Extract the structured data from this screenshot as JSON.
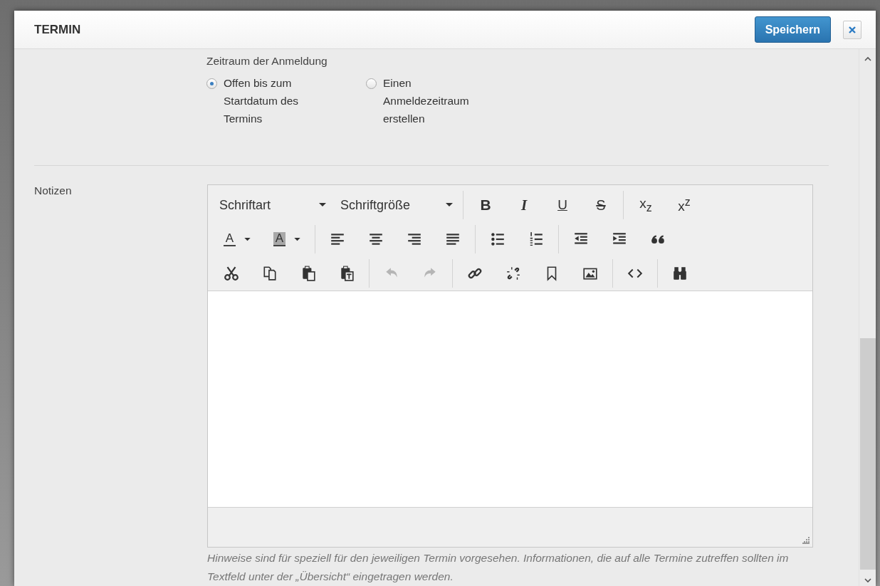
{
  "dialog": {
    "title": "TERMIN",
    "save_button": "Speichern"
  },
  "registration": {
    "label": "Zeitraum der Anmeldung",
    "options": [
      {
        "label": "Offen bis zum Startdatum des Termins",
        "selected": true
      },
      {
        "label": "Einen Anmeldezeitraum erstellen",
        "selected": false
      }
    ]
  },
  "notes": {
    "label": "Notizen",
    "toolbar": [
      [
        [
          {
            "kind": "font",
            "label": "Schriftart",
            "disabled": false
          },
          {
            "kind": "size",
            "label": "Schriftgröße",
            "disabled": false
          }
        ],
        [
          {
            "kind": "bold",
            "label": "B",
            "disabled": false
          },
          {
            "kind": "italic",
            "label": "I",
            "disabled": false
          },
          {
            "kind": "underline",
            "label": "U",
            "disabled": false
          },
          {
            "kind": "strike",
            "label": "S",
            "disabled": false
          }
        ],
        [
          {
            "kind": "subscript",
            "label": "x$_{z}$",
            "disabled": false
          },
          {
            "kind": "superscript",
            "label": "x$^{z}$",
            "disabled": false
          }
        ]
      ],
      [
        [
          {
            "kind": "textcolor",
            "label": "A",
            "disabled": false
          },
          {
            "kind": "bgcolor",
            "label": "A",
            "disabled": false
          }
        ],
        [
          {
            "kind": "alignleft",
            "disabled": false
          },
          {
            "kind": "aligncenter",
            "disabled": false
          },
          {
            "kind": "alignright",
            "disabled": false
          },
          {
            "kind": "justify",
            "disabled": false
          }
        ],
        [
          {
            "kind": "bullets",
            "disabled": false
          },
          {
            "kind": "numbers",
            "disabled": false
          }
        ],
        [
          {
            "kind": "outdent",
            "disabled": false
          },
          {
            "kind": "indent",
            "disabled": false
          },
          {
            "kind": "quote",
            "disabled": false
          }
        ]
      ],
      [
        [
          {
            "kind": "cut",
            "disabled": false
          },
          {
            "kind": "copy",
            "disabled": false
          },
          {
            "kind": "paste",
            "disabled": false
          },
          {
            "kind": "pastetext",
            "disabled": false
          }
        ],
        [
          {
            "kind": "undo",
            "disabled": true
          },
          {
            "kind": "redo",
            "disabled": true
          }
        ],
        [
          {
            "kind": "link",
            "disabled": false
          },
          {
            "kind": "unlink",
            "disabled": false
          },
          {
            "kind": "anchor",
            "disabled": false
          },
          {
            "kind": "image",
            "disabled": false
          }
        ],
        [
          {
            "kind": "source",
            "disabled": false
          }
        ],
        [
          {
            "kind": "find",
            "disabled": false
          }
        ]
      ]
    ],
    "hint": "Hinweise sind für speziell für den jeweiligen Termin vorgesehen. Informationen, die auf alle Termine zutreffen sollten im Textfeld unter der „Übersicht“ eingetragen werden."
  }
}
